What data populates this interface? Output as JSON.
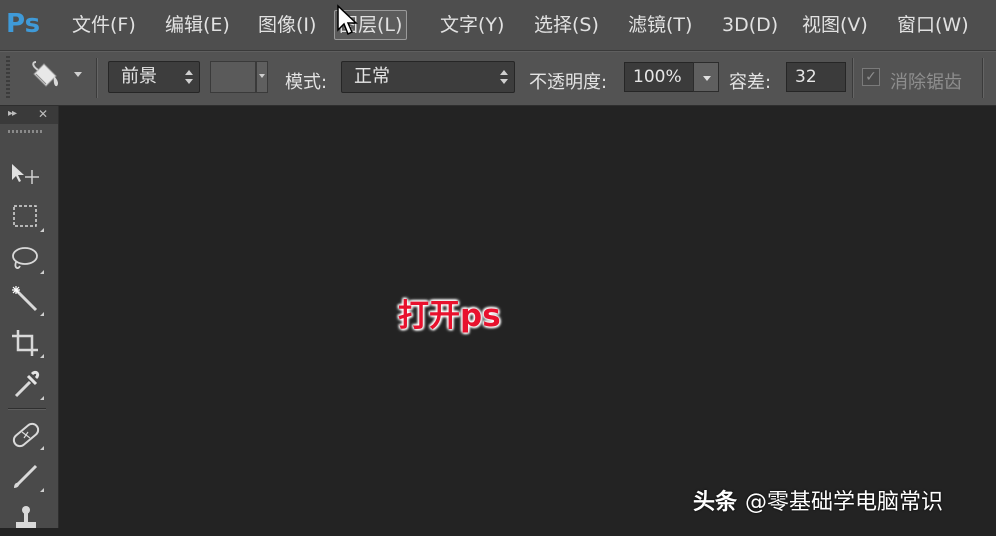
{
  "app": {
    "logo_text": "Ps"
  },
  "menu": {
    "items": [
      "文件(F)",
      "编辑(E)",
      "图像(I)",
      "图层(L)",
      "文字(Y)",
      "选择(S)",
      "滤镜(T)",
      "3D(D)",
      "视图(V)",
      "窗口(W)"
    ],
    "active_index": 3
  },
  "options_bar": {
    "tool_icon": "paint-bucket-icon",
    "fill_source": "前景",
    "mode_label": "模式:",
    "mode_value": "正常",
    "opacity_label": "不透明度:",
    "opacity_value": "100%",
    "tolerance_label": "容差:",
    "tolerance_value": "32",
    "antialias_label": "消除锯齿",
    "antialias_checked": true
  },
  "tools_panel": {
    "collapse_label": "▸▸",
    "close_label": "✕",
    "tools": [
      "move-tool-icon",
      "marquee-tool-icon",
      "lasso-tool-icon",
      "magic-wand-tool-icon",
      "crop-tool-icon",
      "eyedropper-tool-icon",
      "healing-brush-tool-icon",
      "brush-tool-icon",
      "clone-stamp-tool-icon"
    ]
  },
  "overlay": {
    "caption": "打开ps",
    "caption_color": "#e8112d"
  },
  "watermark": {
    "source": "头条",
    "author": "@零基础学电脑常识"
  },
  "colors": {
    "workspace": "#232323",
    "menubar": "#4e4e4e",
    "panel": "#4a4a4a",
    "logo": "#3f9ad8"
  }
}
